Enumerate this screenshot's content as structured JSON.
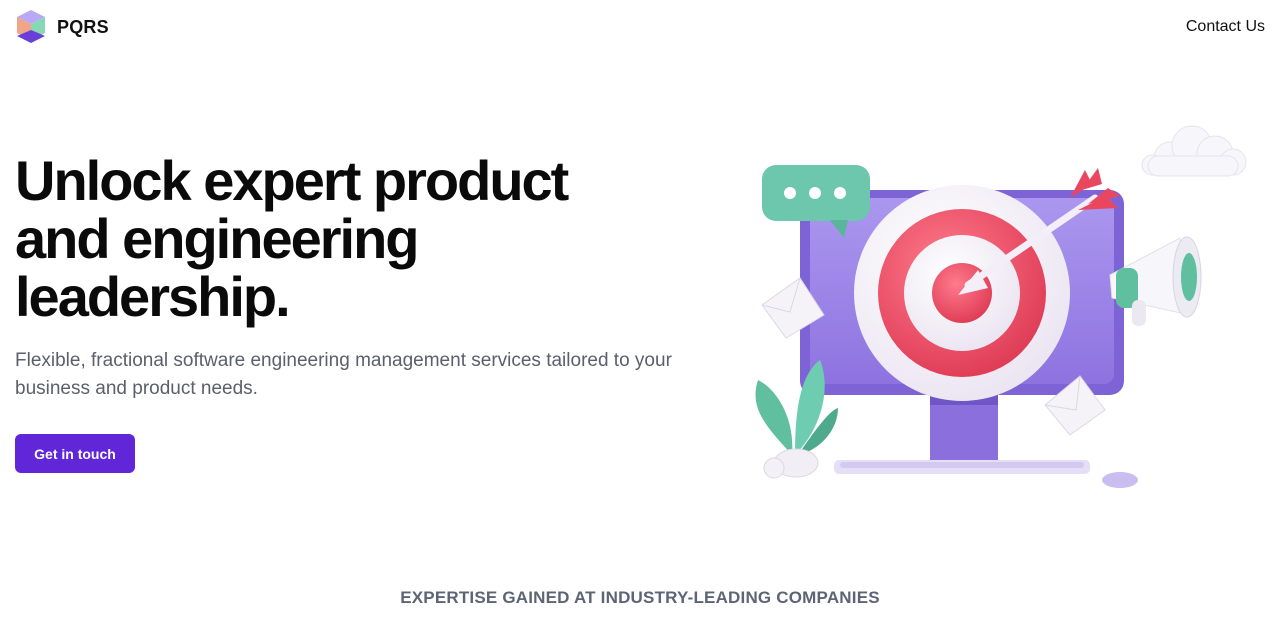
{
  "nav": {
    "brand": "PQRS",
    "logo_icon": "isometric-cube-icon",
    "contact_label": "Contact Us"
  },
  "hero": {
    "title_lines": [
      "Unlock expert product",
      "and engineering",
      "leadership."
    ],
    "subtitle": "Flexible, fractional software engineering management services tailored to your business and product needs.",
    "cta_label": "Get in touch",
    "illustration_icons": [
      "monitor-icon",
      "target-icon",
      "arrow-icon",
      "chat-bubble-icon",
      "megaphone-icon",
      "envelope-icon",
      "plant-icon",
      "cloud-icon",
      "keyboard-icon",
      "mouse-icon"
    ]
  },
  "expertise": {
    "heading": "EXPERTISE GAINED AT INDUSTRY-LEADING COMPANIES"
  },
  "colors": {
    "accent": "#6226d9",
    "heading": "#0a0a0a",
    "subtext": "#5b5f6b",
    "section_heading": "#5c6475",
    "monitor": "#9d86e6",
    "target_red": "#e8475f",
    "teal": "#5fbf9f"
  }
}
